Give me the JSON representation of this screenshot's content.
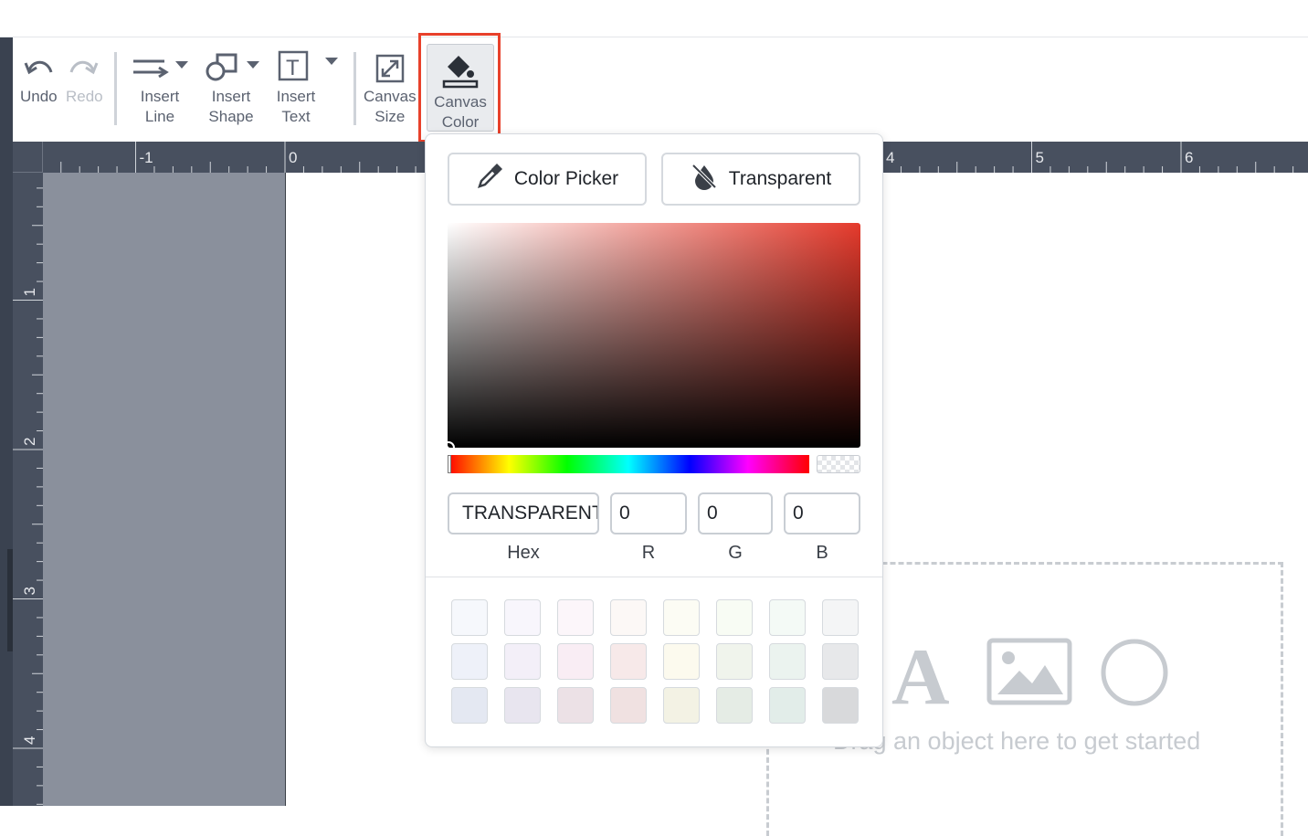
{
  "toolbar": {
    "undo": "Undo",
    "redo": "Redo",
    "insert_line": "Insert\nLine",
    "insert_shape": "Insert\nShape",
    "insert_text": "Insert\nText",
    "canvas_size": "Canvas\nSize",
    "canvas_color": "Canvas\nColor"
  },
  "ruler": {
    "horizontal_labels": [
      "-1",
      "0",
      "4",
      "5",
      "6"
    ],
    "vertical_labels": [
      "1",
      "2",
      "3",
      "4"
    ]
  },
  "dropzone": {
    "text": "Drag an object here to get started"
  },
  "color_picker": {
    "color_picker_button": "Color Picker",
    "transparent_button": "Transparent",
    "hex_value": "TRANSPARENT",
    "r_value": "0",
    "g_value": "0",
    "b_value": "0",
    "hex_label": "Hex",
    "r_label": "R",
    "g_label": "G",
    "b_label": "B",
    "swatches": [
      [
        "#f6f8fc",
        "#f8f6fc",
        "#fcf6fa",
        "#fcf8f6",
        "#fcfcf4",
        "#f8fcf4",
        "#f4faf6",
        "#f4f5f6"
      ],
      [
        "#eef1f9",
        "#f3eff8",
        "#f9edf4",
        "#f7e9e9",
        "#fcfaee",
        "#f0f4ec",
        "#ebf3ef",
        "#e7e8ea"
      ],
      [
        "#e4e8f2",
        "#e8e5ef",
        "#ece1e6",
        "#f0e1e1",
        "#f3f2e4",
        "#e5ece5",
        "#e2ede9",
        "#d8d9db"
      ]
    ]
  },
  "colors": {
    "highlight": "#e8412b",
    "ruler": "#48505f",
    "workspace": "#8a909c"
  }
}
